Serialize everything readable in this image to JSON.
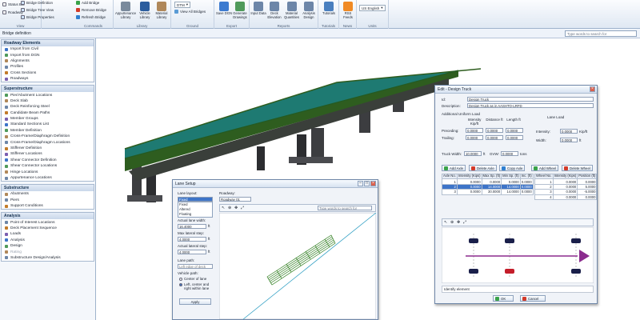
{
  "colors": {
    "deck": "#1e7a72",
    "deck_edge": "#2e5d1f",
    "pier": "#3c3d40",
    "accent": "#3d74c8",
    "lane_line": "#3ca5c7",
    "truck_arrow": "#8b2c8e"
  },
  "ribbon": {
    "view": {
      "items": [
        "Status Bar",
        "Roadway",
        "Bridge Definition",
        "Bridge Tree View",
        "Bridge Properties"
      ],
      "caption": "View"
    },
    "commands": {
      "items": [
        "Add Bridge",
        "Remove Bridge",
        "Refresh Bridge"
      ],
      "caption": "Commands"
    },
    "library": {
      "items": [
        "Appurtenance Library",
        "Vehicle Library",
        "Material Library"
      ],
      "caption": "Library"
    },
    "ground": {
      "dropdown": "DTM",
      "view_all": "View All Bridges",
      "caption": "Ground"
    },
    "export": {
      "items": [
        "Save DGN",
        "Generate Drawings"
      ],
      "caption": "Export"
    },
    "reports": {
      "items": [
        "Input Data",
        "Deck Elevation",
        "Material Quantities",
        "Analysis Design"
      ],
      "caption": "Reports"
    },
    "tutorials": {
      "items": [
        "Tutorials"
      ],
      "caption": "Tutorials"
    },
    "news": {
      "items": [
        "RSS Feeds"
      ],
      "caption": "News"
    },
    "units": {
      "value": "US English",
      "caption": "Units"
    }
  },
  "subbar": {
    "title": "Bridge definition",
    "search_placeholder": "Type words to search for"
  },
  "sidebar": [
    {
      "title": "Roadway Elements",
      "items": [
        {
          "label": "Import from Civil",
          "icon": "import-icon"
        },
        {
          "label": "Import from DGN",
          "icon": "import-icon"
        },
        {
          "label": "Alignments",
          "icon": "alignment-icon"
        },
        {
          "label": "Profiles",
          "icon": "profile-icon"
        },
        {
          "label": "Cross Sections",
          "icon": "cross-section-icon"
        },
        {
          "label": "Roadways",
          "icon": "roadway-icon"
        }
      ]
    },
    {
      "title": "Superstructure",
      "items": [
        {
          "label": "Pier/Abutment Locations",
          "icon": "pier-icon"
        },
        {
          "label": "Deck Slab",
          "icon": "deck-icon"
        },
        {
          "label": "Deck Reinforcing Steel",
          "icon": "rebar-icon"
        },
        {
          "label": "Candidate Beam Paths",
          "icon": "beam-icon"
        },
        {
          "label": "Member Groups",
          "icon": "group-icon"
        },
        {
          "label": "Standard Sections List",
          "icon": "section-icon"
        },
        {
          "label": "Member Definition",
          "icon": "member-icon"
        },
        {
          "label": "Cross-Frame/Diaphragm Definition",
          "icon": "frame-icon"
        },
        {
          "label": "Cross-Frame/Diaphragm Locations",
          "icon": "frame-icon"
        },
        {
          "label": "Stiffener Definition",
          "icon": "stiffener-icon"
        },
        {
          "label": "Stiffener Locations",
          "icon": "stiffener-icon"
        },
        {
          "label": "Shear Connector Definition",
          "icon": "connector-icon"
        },
        {
          "label": "Shear Connector Locations",
          "icon": "connector-icon"
        },
        {
          "label": "Hinge Locations",
          "icon": "hinge-icon"
        },
        {
          "label": "Appurtenance Locations",
          "icon": "appurtenance-icon"
        }
      ]
    },
    {
      "title": "Substructure",
      "items": [
        {
          "label": "Abutments",
          "icon": "abutment-icon"
        },
        {
          "label": "Piers",
          "icon": "pier-icon"
        },
        {
          "label": "Support Conditions",
          "icon": "support-icon"
        }
      ]
    },
    {
      "title": "Analysis",
      "items": [
        {
          "label": "Point of Interest Locations",
          "icon": "poi-icon"
        },
        {
          "label": "Deck Placement Sequence",
          "icon": "sequence-icon"
        },
        {
          "label": "Loads",
          "icon": "loads-icon"
        },
        {
          "label": "Analysis",
          "icon": "analysis-icon"
        },
        {
          "label": "Design",
          "icon": "design-icon"
        },
        {
          "label": "Rating",
          "icon": "rating-icon",
          "disabled": true
        },
        {
          "label": "Substructure Design/Analysis",
          "icon": "substructure-icon"
        }
      ]
    }
  ],
  "lane_setup": {
    "title": "Lane Setup",
    "lane_layout_label": "Lane layout:",
    "lane_layout_value": "Fixed",
    "lane_layout_options": [
      "Fixed",
      "Altered",
      "Floating"
    ],
    "roadway_label": "Roadway:",
    "roadway_value": "Roadway 01",
    "search_placeholder": "Type words to search for",
    "actual_width_label": "Actual lane width:",
    "actual_width_value": "16.4000",
    "max_lateral_label": "Max lateral step:",
    "max_lateral_value": "4.0000",
    "actual_lateral_label": "Actual lateral step:",
    "actual_lateral_value": "4.0000",
    "unit_ft": "ft",
    "lane_path_label": "Lane path:",
    "lane_path_value": "Left edge of deck",
    "vehicle_path_label": "Vehicle path:",
    "radio_center": "Center of lane",
    "radio_left": "Left, center and right within lane",
    "apply": "Apply"
  },
  "truck": {
    "title": "Edit - Design Truck",
    "id_label": "Id:",
    "id_value": "Design Truck",
    "desc_label": "Description:",
    "desc_value": "Design Truck as in AASHTO-LRFD",
    "uniform_label": "Additional Uniform Load",
    "lane_load_label": "Lane Load",
    "col_intensity": "Intensity Kip/ft",
    "col_distance": "Distance ft",
    "col_length": "Length ft",
    "preceding_label": "Preceding:",
    "preceding": [
      "0.0000",
      "0.0000",
      "0.0000"
    ],
    "trailing_label": "Trailing:",
    "trailing": [
      "0.0000",
      "0.0000",
      "0.0000"
    ],
    "intensity_label": "Intensity:",
    "intensity_value": "0.0000",
    "intensity_unit": "Kip/ft",
    "width_label": "Width:",
    "width_value": "0.0000",
    "width_unit": "ft",
    "truck_width_label": "Truck Width:",
    "truck_width_value": "10.0000",
    "truck_width_unit": "ft",
    "gvw_label": "GVW:",
    "gvw_value": "0.0000",
    "gvw_unit": "tons",
    "add_axle": "Add Axle",
    "delete_axle": "Delete Axle",
    "copy_axle": "Copy Axle",
    "add_wheel": "Add Wheel",
    "delete_wheel": "Delete Wheel",
    "axle_headers": [
      "Axle No.",
      "Intensity (Kips)",
      "Max Sp. (ft)",
      "Min Sp. (ft)",
      "Inc. (ft)"
    ],
    "axles": [
      [
        "1",
        "0.0000",
        "0.0000",
        "0.0000",
        "0.0000"
      ],
      [
        "2",
        "0.0000",
        "14.0000",
        "14.0000",
        "0.0000"
      ],
      [
        "3",
        "0.0000",
        "30.0000",
        "14.0000",
        "0.0000"
      ]
    ],
    "wheel_headers": [
      "Wheel No.",
      "Intensity (Kips)",
      "Position (ft)"
    ],
    "wheels": [
      [
        "1",
        "0.0000",
        "0.0000"
      ],
      [
        "2",
        "0.0000",
        "5.0000"
      ],
      [
        "3",
        "0.0000",
        "-5.0000"
      ],
      [
        "4",
        "0.0000",
        "0.0000"
      ]
    ],
    "identify": "Identify element",
    "ok": "OK",
    "cancel": "Cancel"
  }
}
